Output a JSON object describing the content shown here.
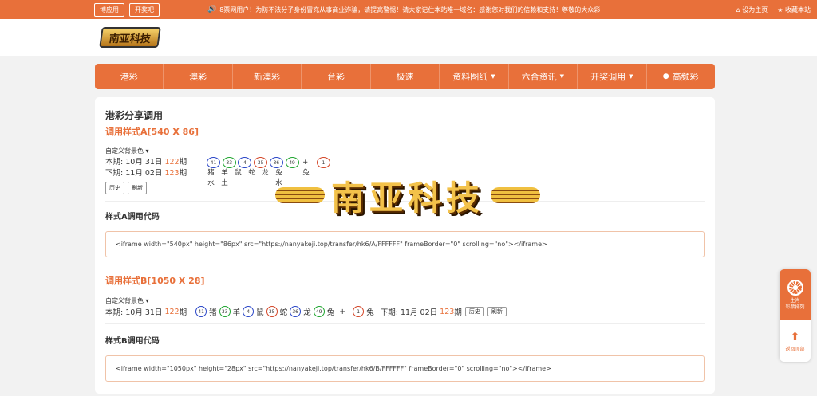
{
  "topbar": {
    "buttons": [
      "博应用",
      "开奖吧"
    ],
    "notice": "8票网用户！为防不法分子身份冒充从事商业诈骗，请提高警惕！请大家记住本站唯一域名：感谢您对我们的信赖和支持！尊敬的大众彩",
    "set_home": "设为主页",
    "bookmark": "收藏本站"
  },
  "logo_text": "南亚科技",
  "nav": [
    "港彩",
    "澳彩",
    "新澳彩",
    "台彩",
    "极速",
    "资料图纸",
    "六合资讯",
    "开奖调用",
    "高频彩"
  ],
  "card": {
    "title": "港彩分享调用",
    "styleA": {
      "heading": "调用样式A[540 X 86]",
      "bg_label": "自定义背景色",
      "current": {
        "label": "本期:",
        "date": "10月 31日",
        "issue": "122",
        "suffix": "期"
      },
      "next": {
        "label": "下期:",
        "date": "11月 02日",
        "issue": "123",
        "suffix": "期"
      },
      "balls": [
        {
          "num": "41",
          "color": "blue",
          "zodiac": "猪",
          "element": "水"
        },
        {
          "num": "33",
          "color": "green",
          "zodiac": "羊",
          "element": "土"
        },
        {
          "num": "4",
          "color": "blue",
          "zodiac": "鼠",
          "element": ""
        },
        {
          "num": "35",
          "color": "red",
          "zodiac": "蛇",
          "element": ""
        },
        {
          "num": "36",
          "color": "blue",
          "zodiac": "龙",
          "element": ""
        },
        {
          "num": "49",
          "color": "green",
          "zodiac": "兔",
          "element": "水"
        }
      ],
      "plus": "+",
      "special": {
        "num": "1",
        "color": "red",
        "zodiac": "兔"
      },
      "history_btn": "历史",
      "refresh_btn": "刷新",
      "code_label": "样式A调用代码",
      "code": "<iframe width=\"540px\" height=\"86px\" src=\"https://nanyakeji.top/transfer/hk6/A/FFFFFF\" frameBorder=\"0\" scrolling=\"no\"></iframe>"
    },
    "styleB": {
      "heading": "调用样式B[1050 X 28]",
      "bg_label": "自定义背景色",
      "current": {
        "label": "本期:",
        "date": "10月 31日",
        "issue": "122",
        "suffix": "期"
      },
      "next": {
        "label": "下期:",
        "date": "11月 02日",
        "issue": "123",
        "suffix": "期"
      },
      "balls": [
        {
          "num": "41",
          "color": "blue",
          "zodiac": "猪"
        },
        {
          "num": "33",
          "color": "green",
          "zodiac": "羊"
        },
        {
          "num": "4",
          "color": "blue",
          "zodiac": "鼠"
        },
        {
          "num": "35",
          "color": "red",
          "zodiac": "蛇"
        },
        {
          "num": "36",
          "color": "blue",
          "zodiac": "龙"
        },
        {
          "num": "49",
          "color": "green",
          "zodiac": "兔"
        }
      ],
      "plus": "+",
      "special": {
        "num": "1",
        "color": "red",
        "zodiac": "兔"
      },
      "history_btn": "历史",
      "refresh_btn": "刷新",
      "code_label": "样式B调用代码",
      "code": "<iframe width=\"1050px\" height=\"28px\" src=\"https://nanyakeji.top/transfer/hk6/B/FFFFFF\" frameBorder=\"0\" scrolling=\"no\"></iframe>"
    }
  },
  "watermark_text": "南亚科技",
  "side": {
    "top_label": "生肖\n彩票排列",
    "bottom_label": "返回顶部"
  },
  "colors": {
    "accent": "#e8703a",
    "ball_blue": "#2a46c7",
    "ball_green": "#1fa52f",
    "ball_red": "#d34527"
  }
}
